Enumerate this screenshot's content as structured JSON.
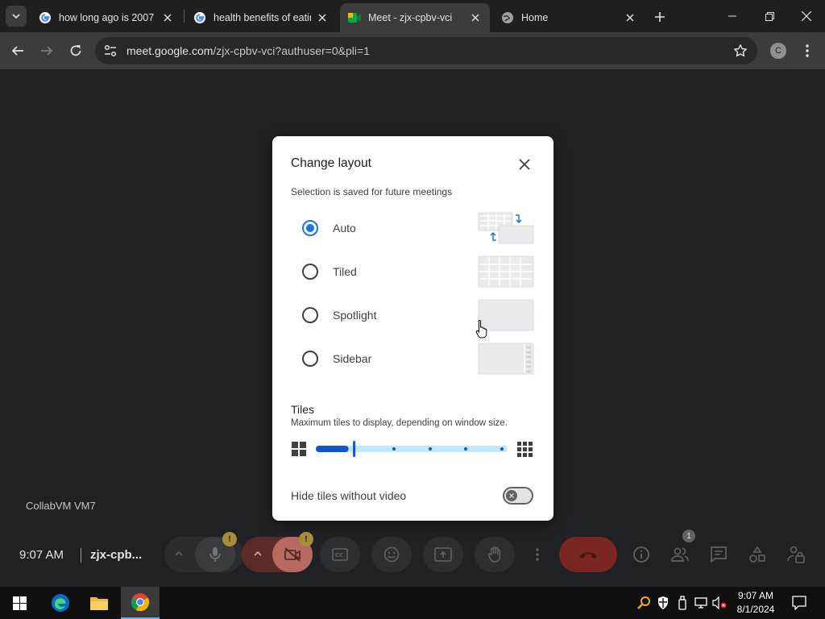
{
  "browser": {
    "tabs": [
      {
        "title": "how long ago is 2007 -",
        "favicon": "google-g-icon"
      },
      {
        "title": "health benefits of eatin",
        "favicon": "google-g-icon"
      },
      {
        "title": "Meet - zjx-cpbv-vci",
        "favicon": "google-meet-icon",
        "active": true
      },
      {
        "title": "Home",
        "favicon": "globe-icon"
      }
    ],
    "url_host": "meet.google.com",
    "url_path": "/zjx-cpbv-vci?authuser=0&pli=1",
    "profile_initial": "C"
  },
  "dialog": {
    "title": "Change layout",
    "subtitle": "Selection is saved for future meetings",
    "options": [
      {
        "label": "Auto",
        "selected": true
      },
      {
        "label": "Tiled",
        "selected": false
      },
      {
        "label": "Spotlight",
        "selected": false
      },
      {
        "label": "Sidebar",
        "selected": false
      }
    ],
    "tiles_title": "Tiles",
    "tiles_subtitle": "Maximum tiles to display, depending on window size.",
    "tiles_slider_level": 0.2,
    "hide_tiles_label": "Hide tiles without video",
    "hide_tiles_on": false
  },
  "meet": {
    "vm_label": "CollabVM VM7",
    "time": "9:07 AM",
    "meeting_code": "zjx-cpb...",
    "warning_mark": "!",
    "people_count": "1"
  },
  "taskbar": {
    "clock_time": "9:07 AM",
    "clock_date": "8/1/2024"
  },
  "colors": {
    "accent": "#1a73e8",
    "end_call": "#ea4335",
    "background": "#202124"
  }
}
